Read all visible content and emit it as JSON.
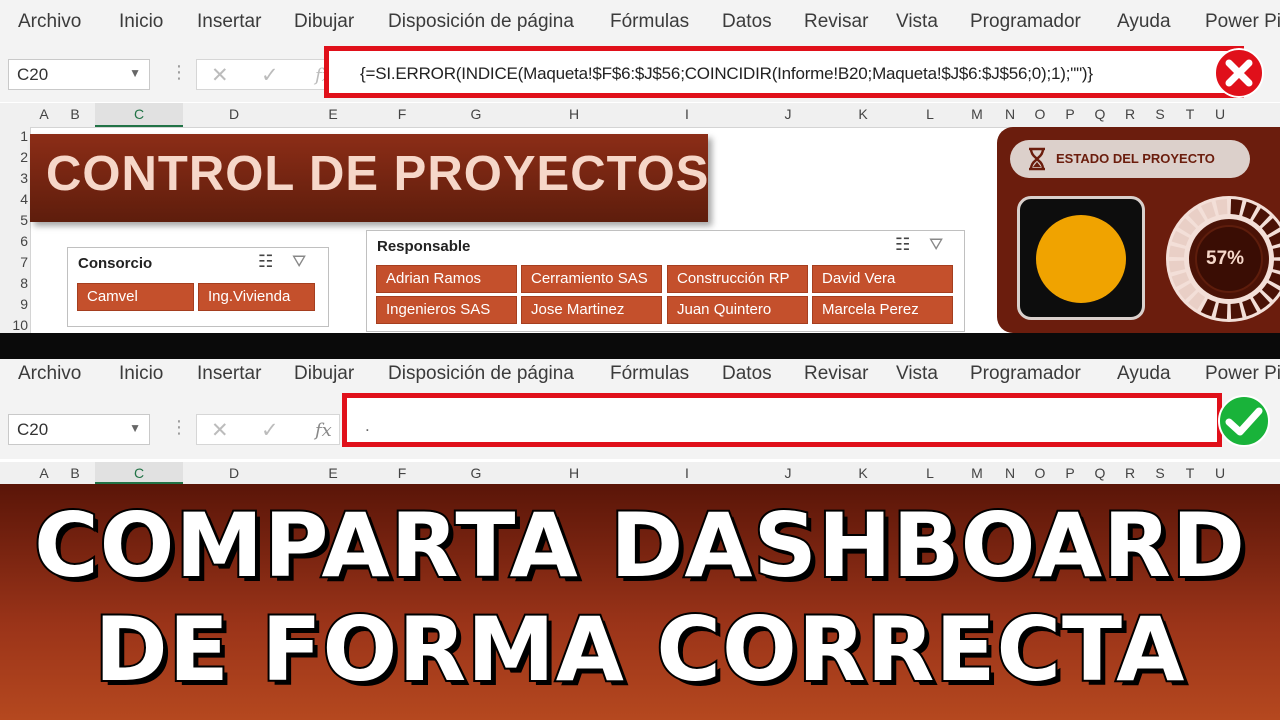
{
  "menu": [
    "Archivo",
    "Inicio",
    "Insertar",
    "Dibujar",
    "Disposición de página",
    "Fórmulas",
    "Datos",
    "Revisar",
    "Vista",
    "Programador",
    "Ayuda",
    "Power Pi"
  ],
  "namebox": "C20",
  "formula_top": "{=SI.ERROR(INDICE(Maqueta!$F$6:$J$56;COINCIDIR(Informe!B20;Maqueta!$J$6:$J$56;0);1);\"\")}",
  "formula_bottom": ".",
  "fx_label": "fx",
  "columns": [
    "A",
    "B",
    "C",
    "D",
    "E",
    "F",
    "G",
    "H",
    "I",
    "J",
    "K",
    "L",
    "M",
    "N",
    "O",
    "P",
    "Q",
    "R",
    "S",
    "T",
    "U"
  ],
  "rows": [
    "1",
    "2",
    "3",
    "4",
    "5",
    "6",
    "7",
    "8",
    "9",
    "10"
  ],
  "title": "CONTROL DE PROYECTOS",
  "slicer_consorcio": {
    "title": "Consorcio",
    "items": [
      "Camvel",
      "Ing.Vivienda"
    ]
  },
  "slicer_responsable": {
    "title": "Responsable",
    "items": [
      "Adrian Ramos",
      "Cerramiento SAS",
      "Construcción RP",
      "David Vera",
      "Ingenieros SAS",
      "Jose Martinez",
      "Juan Quintero",
      "Marcela Perez"
    ]
  },
  "status": {
    "label": "ESTADO DEL PROYECTO",
    "percent": "57%",
    "progress": 0.57,
    "light_color": "#f0a300"
  },
  "headline": {
    "line1": "COMPARTA DASHBOARD",
    "line2": "DE FORMA CORRECTA"
  },
  "colors": {
    "accent": "#c4502c",
    "error": "#e0101a",
    "ok": "#19b33a"
  }
}
